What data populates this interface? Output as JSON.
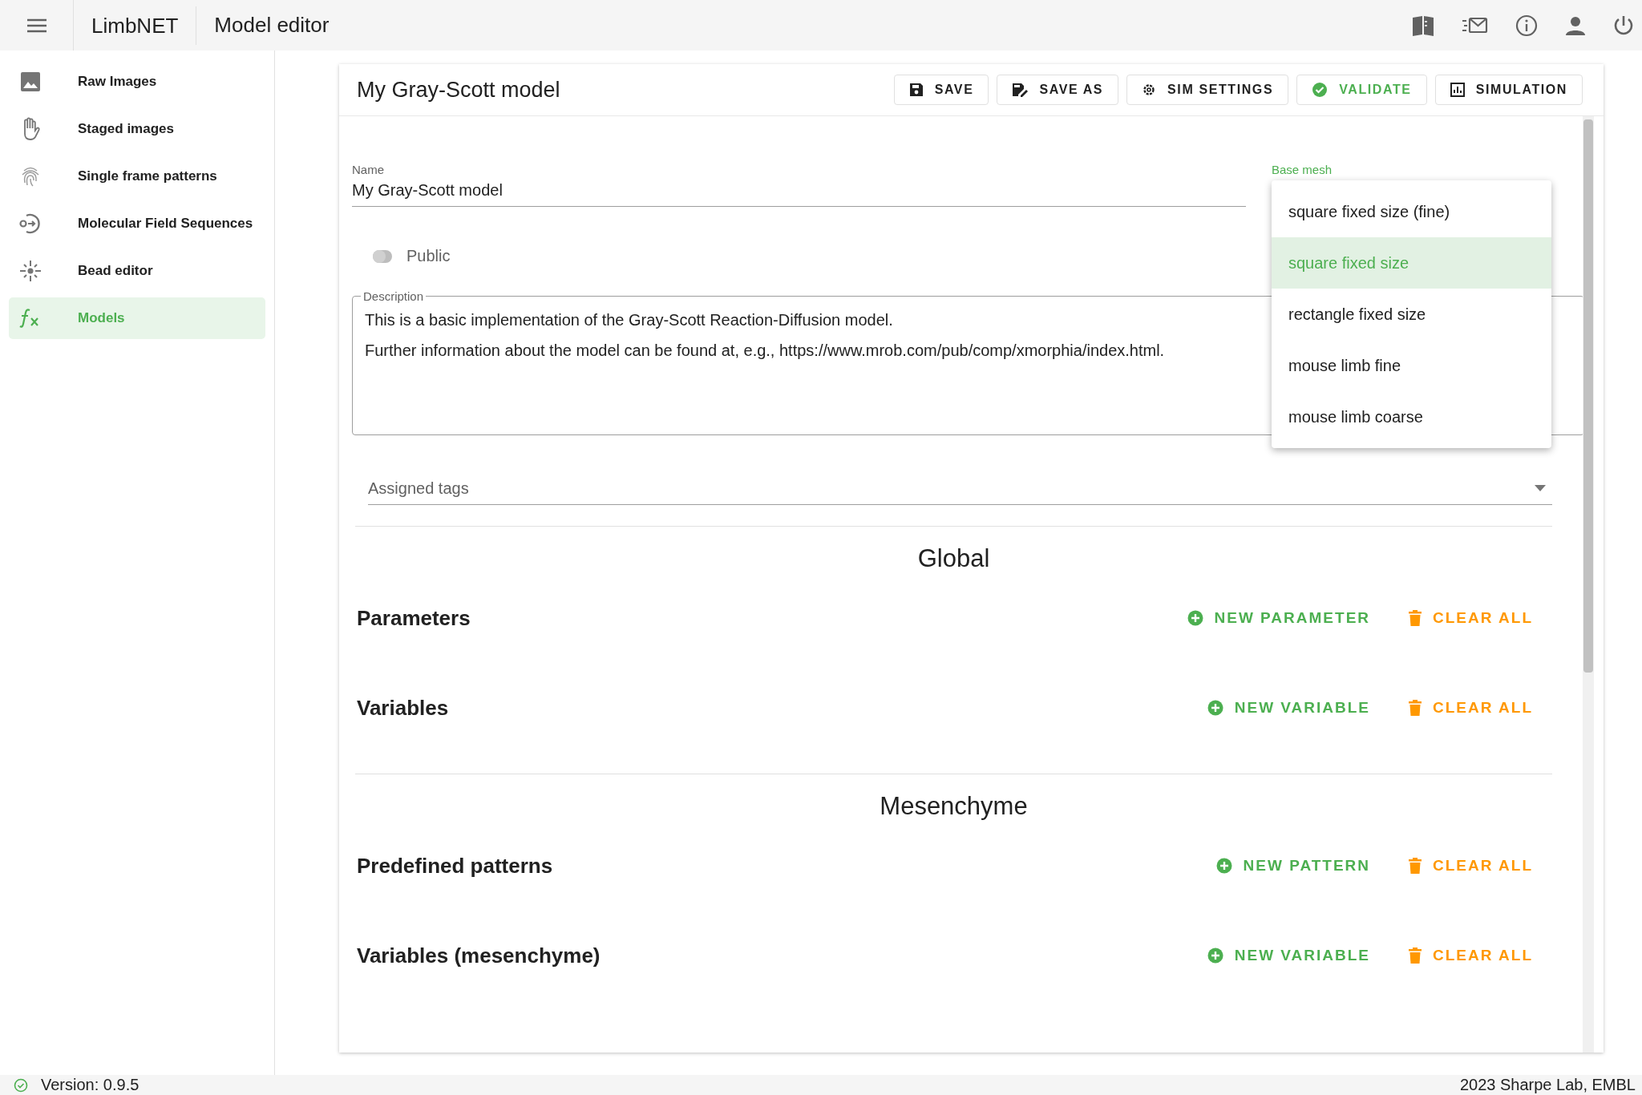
{
  "app_bar": {
    "brand": "LimbNET",
    "title": "Model editor"
  },
  "sidebar": {
    "items": [
      {
        "label": "Raw Images",
        "selected": false
      },
      {
        "label": "Staged images",
        "selected": false
      },
      {
        "label": "Single frame patterns",
        "selected": false
      },
      {
        "label": "Molecular Field Sequences",
        "selected": false
      },
      {
        "label": "Bead editor",
        "selected": false
      },
      {
        "label": "Models",
        "selected": true
      }
    ]
  },
  "editor": {
    "title": "My Gray-Scott model",
    "toolbar": [
      {
        "label": "SAVE",
        "color": "#212121"
      },
      {
        "label": "SAVE AS",
        "color": "#212121"
      },
      {
        "label": "SIM SETTINGS",
        "color": "#212121"
      },
      {
        "label": "VALIDATE",
        "color": "#4caf50"
      },
      {
        "label": "SIMULATION",
        "color": "#212121"
      }
    ],
    "name": {
      "label": "Name",
      "value": "My Gray-Scott model"
    },
    "base_mesh": {
      "label": "Base mesh",
      "expanded": true,
      "options": [
        {
          "label": "square fixed size (fine)",
          "selected": false
        },
        {
          "label": "square fixed size",
          "selected": true
        },
        {
          "label": "rectangle fixed size",
          "selected": false
        },
        {
          "label": "mouse limb fine",
          "selected": false
        },
        {
          "label": "mouse limb coarse",
          "selected": false
        }
      ]
    },
    "public": {
      "label": "Public",
      "on": false
    },
    "description": {
      "label": "Description",
      "lines": [
        "This is a basic implementation of the Gray-Scott Reaction-Diffusion model.",
        "Further information about the model can be found at, e.g., https://www.mrob.com/pub/comp/xmorphia/index.html."
      ]
    },
    "tags": {
      "placeholder": "Assigned tags"
    },
    "sections": [
      {
        "kind": "heading",
        "title": "Global"
      },
      {
        "kind": "group",
        "title": "Parameters",
        "add": "NEW PARAMETER",
        "clear": "CLEAR ALL"
      },
      {
        "kind": "group",
        "title": "Variables",
        "add": "NEW VARIABLE",
        "clear": "CLEAR ALL"
      },
      {
        "kind": "heading",
        "title": "Mesenchyme"
      },
      {
        "kind": "group",
        "title": "Predefined patterns",
        "add": "NEW PATTERN",
        "clear": "CLEAR ALL"
      },
      {
        "kind": "group",
        "title": "Variables (mesenchyme)",
        "add": "NEW VARIABLE",
        "clear": "CLEAR ALL"
      }
    ]
  },
  "status_bar": {
    "version": "Version: 0.9.5",
    "credit": "2023 Sharpe Lab, EMBL"
  }
}
